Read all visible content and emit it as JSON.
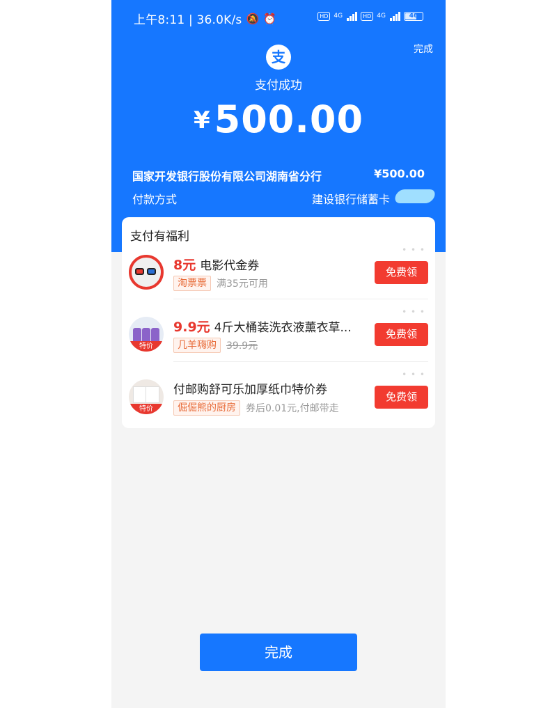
{
  "status_bar": {
    "time_speed": "上午8:11 | 36.0K/s",
    "mute_icon": "bell-off-icon",
    "alarm_icon": "alarm-icon",
    "hd1": "HD",
    "net1": "4G",
    "hd2": "HD",
    "net2": "4G",
    "battery": "46"
  },
  "header": {
    "top_done": "完成",
    "logo_glyph": "支",
    "status": "支付成功",
    "currency": "¥",
    "amount": "500.00"
  },
  "details": {
    "payee": "国家开发银行股份有限公司湖南省分行",
    "payee_amount": "¥500.00",
    "method_label": "付款方式",
    "method_value": "建设银行储蓄卡"
  },
  "benefits": {
    "title": "支付有福利",
    "items": [
      {
        "price": "8元",
        "title": "电影代金券",
        "shop": "淘票票",
        "note": "满35元可用",
        "button": "免费领",
        "thumb_badge": ""
      },
      {
        "price": "9.9元",
        "title": "4斤大桶装洗衣液薰衣草...",
        "shop": "几羊嗨购",
        "note": "39.9元",
        "button": "免费领",
        "thumb_badge": "特价"
      },
      {
        "price": "",
        "title": "付邮购舒可乐加厚纸巾特价券",
        "shop": "倔倔熊的厨房",
        "note": "券后0.01元,付邮带走",
        "button": "免费领",
        "thumb_badge": "特价"
      }
    ]
  },
  "footer": {
    "done": "完成"
  },
  "colors": {
    "brand_blue": "#1677ff",
    "price_red": "#e8382f",
    "button_red": "#f23b30"
  }
}
